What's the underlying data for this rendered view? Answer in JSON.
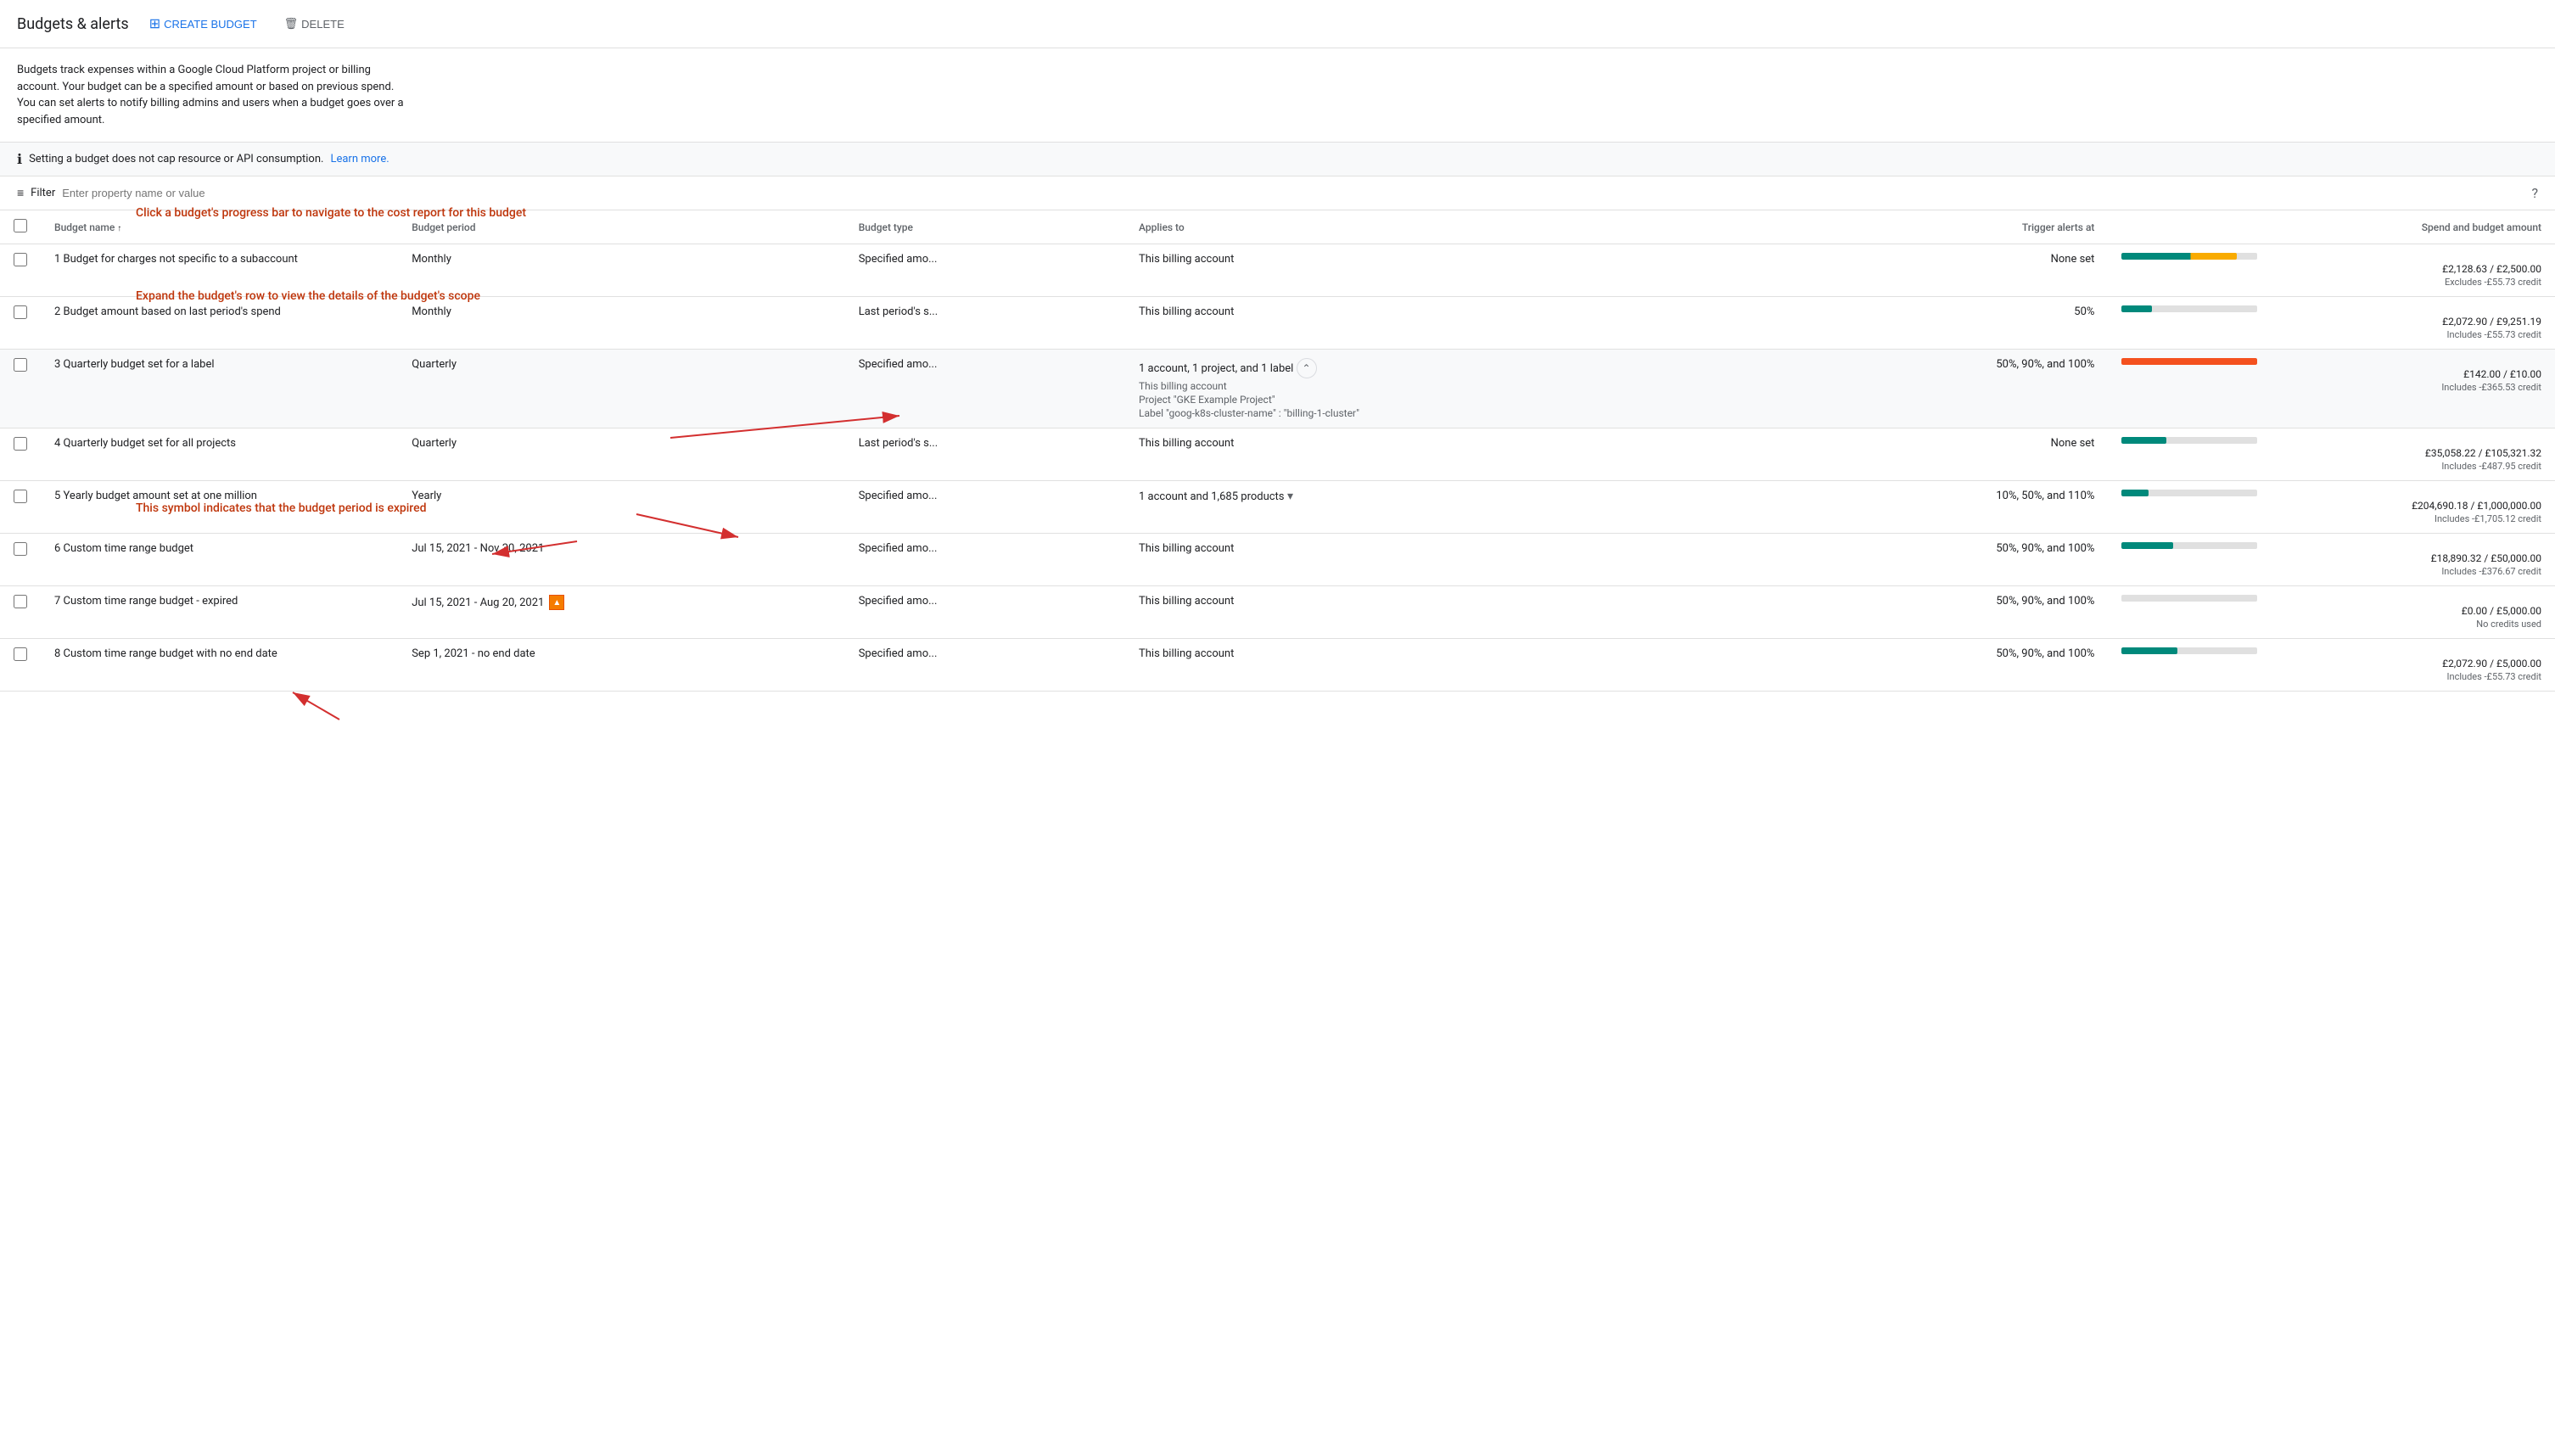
{
  "header": {
    "title": "Budgets & alerts",
    "create_label": "CREATE BUDGET",
    "delete_label": "DELETE"
  },
  "description": {
    "text": "Budgets track expenses within a Google Cloud Platform project or billing account. Your budget can be a specified amount or based on previous spend. You can set alerts to notify billing admins and users when a budget goes over a specified amount."
  },
  "info_bar": {
    "text": "Setting a budget does not cap resource or API consumption.",
    "learn_more": "Learn more."
  },
  "filter": {
    "label": "Filter",
    "placeholder": "Enter property name or value"
  },
  "table": {
    "columns": [
      "Budget name",
      "Budget period",
      "Budget type",
      "Applies to",
      "Trigger alerts at",
      "Spend and budget amount"
    ],
    "rows": [
      {
        "id": 1,
        "name": "1 Budget for charges not specific to a subaccount",
        "period": "Monthly",
        "type": "Specified amo...",
        "applies_to": "This billing account",
        "trigger": "None set",
        "spend": "£2,128.63 / £2,500.00",
        "credit": "Excludes -£55.73 credit",
        "progress": 85,
        "progress_type": "yellow-orange",
        "expanded": false
      },
      {
        "id": 2,
        "name": "2 Budget amount based on last period's spend",
        "period": "Monthly",
        "type": "Last period's s...",
        "applies_to": "This billing account",
        "trigger": "50%",
        "spend": "£2,072.90 / £9,251.19",
        "credit": "Includes -£55.73 credit",
        "progress": 22,
        "progress_type": "teal",
        "expanded": false
      },
      {
        "id": 3,
        "name": "3 Quarterly budget set for a label",
        "period": "Quarterly",
        "type": "Specified amo...",
        "applies_to": "1 account, 1 project, and 1 label",
        "applies_details": [
          "This billing account",
          "Project \"GKE Example Project\"",
          "Label \"goog-k8s-cluster-name\" : \"billing-1-cluster\""
        ],
        "trigger": "50%, 90%, and 100%",
        "spend": "£142.00 / £10.00",
        "credit": "Includes -£365.53 credit",
        "progress": 100,
        "progress_type": "orange",
        "expanded": true,
        "has_chevron": true
      },
      {
        "id": 4,
        "name": "4 Quarterly budget set for all projects",
        "period": "Quarterly",
        "type": "Last period's s...",
        "applies_to": "This billing account",
        "trigger": "None set",
        "spend": "£35,058.22 / £105,321.32",
        "credit": "Includes -£487.95 credit",
        "progress": 33,
        "progress_type": "teal",
        "expanded": false
      },
      {
        "id": 5,
        "name": "5 Yearly budget amount set at one million",
        "period": "Yearly",
        "type": "Specified amo...",
        "applies_to": "1 account and 1,685 products",
        "trigger": "10%, 50%, and 110%",
        "spend": "£204,690.18 / £1,000,000.00",
        "credit": "Includes -£1,705.12 credit",
        "progress": 20,
        "progress_type": "teal",
        "expanded": false,
        "has_dropdown": true
      },
      {
        "id": 6,
        "name": "6 Custom time range budget",
        "period": "Jul 15, 2021 - Nov 30, 2021",
        "type": "Specified amo...",
        "applies_to": "This billing account",
        "trigger": "50%, 90%, and 100%",
        "spend": "£18,890.32 / £50,000.00",
        "credit": "Includes -£376.67 credit",
        "progress": 38,
        "progress_type": "teal",
        "expanded": false
      },
      {
        "id": 7,
        "name": "7 Custom time range budget - expired",
        "period": "Jul 15, 2021 - Aug 20, 2021",
        "type": "Specified amo...",
        "applies_to": "This billing account",
        "trigger": "50%, 90%, and 100%",
        "spend": "£0.00 / £5,000.00",
        "credit": "No credits used",
        "progress": 0,
        "progress_type": "teal",
        "expanded": false,
        "expired": true
      },
      {
        "id": 8,
        "name": "8 Custom time range budget with no end date",
        "period": "Sep 1, 2021 - no end date",
        "type": "Specified amo...",
        "applies_to": "This billing account",
        "trigger": "50%, 90%, and 100%",
        "spend": "£2,072.90 / £5,000.00",
        "credit": "Includes -£55.73 credit",
        "progress": 41,
        "progress_type": "teal",
        "expanded": false
      }
    ],
    "callouts": {
      "progress_bar": "Click a budget's progress bar to navigate to the cost report for this budget",
      "expand_row": "Expand the budget's row to view the details of the budget's scope",
      "expired_symbol": "This symbol indicates that the budget period is expired"
    }
  }
}
